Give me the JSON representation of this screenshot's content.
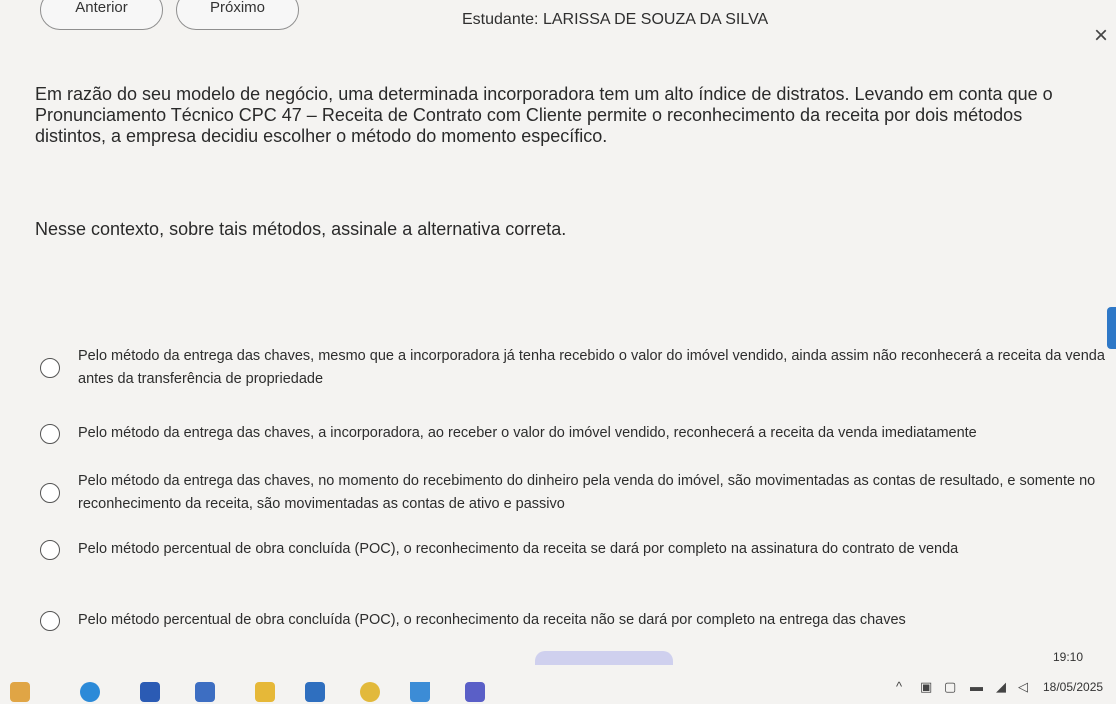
{
  "nav": {
    "prev_label": "Anterior",
    "next_label": "Próximo"
  },
  "header": {
    "student": "Estudante: LARISSA DE SOUZA DA SILVA",
    "close_glyph": "×"
  },
  "question": {
    "text": "Em razão do seu modelo de negócio, uma determinada incorporadora tem um alto índice de distratos. Levando em conta que o Pronunciamento Técnico CPC 47 – Receita de Contrato com Cliente permite o reconhecimento da receita por dois métodos distintos, a empresa decidiu escolher o método do momento específico.",
    "prompt": "Nesse contexto, sobre tais métodos, assinale a alternativa correta."
  },
  "options": [
    "Pelo método da entrega das chaves, mesmo que a incorporadora já tenha recebido o valor do imóvel vendido, ainda assim não reconhecerá a receita da venda antes da transferência de propriedade",
    "Pelo método da entrega das chaves, a incorporadora, ao receber o valor do imóvel vendido, reconhecerá a receita da venda imediatamente",
    "Pelo método da entrega das chaves, no momento do recebimento do dinheiro pela venda do imóvel, são movimentadas as contas de resultado, e somente no reconhecimento da receita, são movimentadas as contas de ativo e passivo",
    "Pelo método percentual de obra concluída (POC), o reconhecimento da receita se dará por completo na assinatura do contrato de venda",
    "Pelo método percentual de obra concluída (POC), o reconhecimento da receita não se dará por completo na entrega das chaves"
  ],
  "taskbar": {
    "time": "19:10",
    "date": "18/05/2025",
    "icons": [
      "weather-icon",
      "edge-icon",
      "word-icon",
      "calendar-icon",
      "folder-icon",
      "app-icon",
      "chrome-icon",
      "drive-icon",
      "teams-icon"
    ],
    "tray_icons": [
      "chevron-up-icon",
      "camera-icon",
      "screen-icon",
      "battery-icon",
      "wifi-icon",
      "volume-icon"
    ]
  },
  "colors": {
    "accent": "#2e78c7",
    "background": "#f4f3f1"
  }
}
